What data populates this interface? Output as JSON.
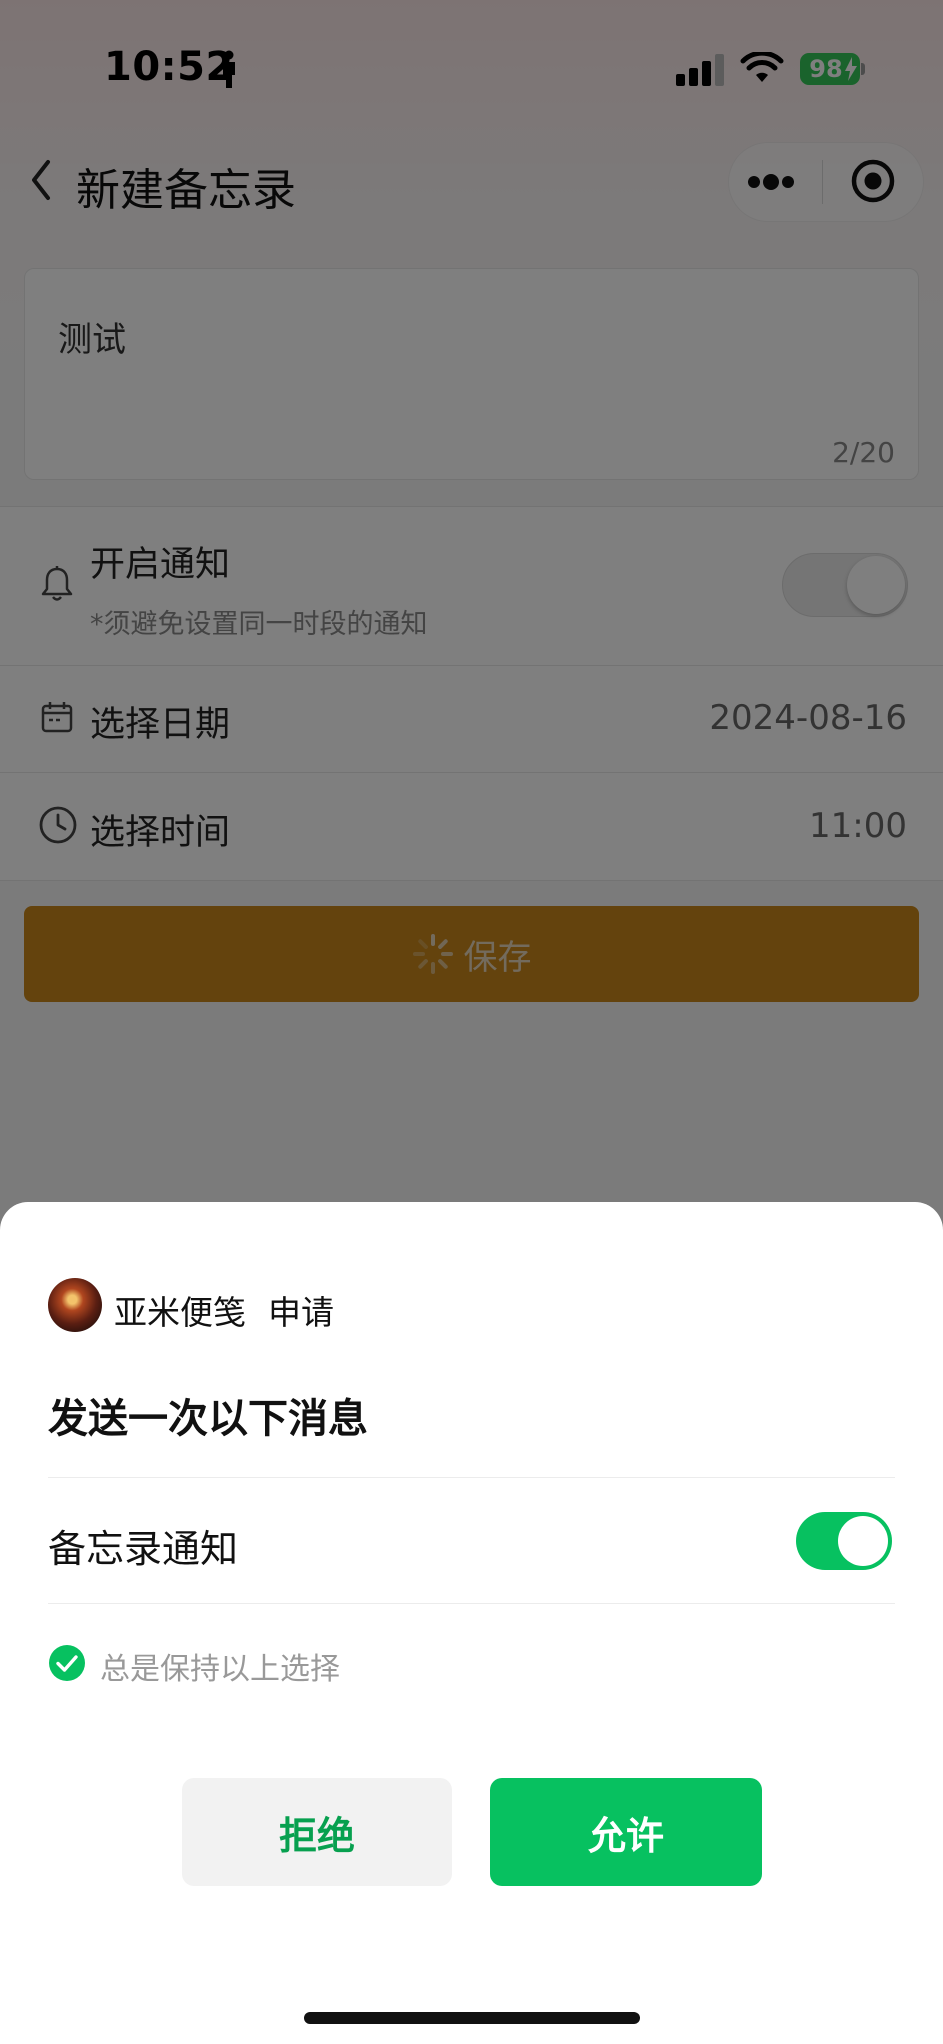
{
  "status_bar": {
    "time": "10:52",
    "battery": "98"
  },
  "nav": {
    "title": "新建备忘录",
    "back_icon": "chevron-left-icon",
    "more_icon": "more-dots-icon",
    "record_icon": "target-icon"
  },
  "memo": {
    "text": "测试",
    "count": "2/20"
  },
  "notify": {
    "title": "开启通知",
    "subtitle": "*须避免设置同一时段的通知",
    "enabled": false
  },
  "date": {
    "label": "选择日期",
    "value": "2024-08-16"
  },
  "time": {
    "label": "选择时间",
    "value": "11:00"
  },
  "save": {
    "label": "保存",
    "color": "#c8861a"
  },
  "sheet": {
    "app_name": "亚米便笺",
    "apply": "申请",
    "heading": "发送一次以下消息",
    "permission_label": "备忘录通知",
    "permission_enabled": true,
    "keep_choice": "总是保持以上选择",
    "reject": "拒绝",
    "allow": "允许",
    "accent": "#07c160"
  }
}
